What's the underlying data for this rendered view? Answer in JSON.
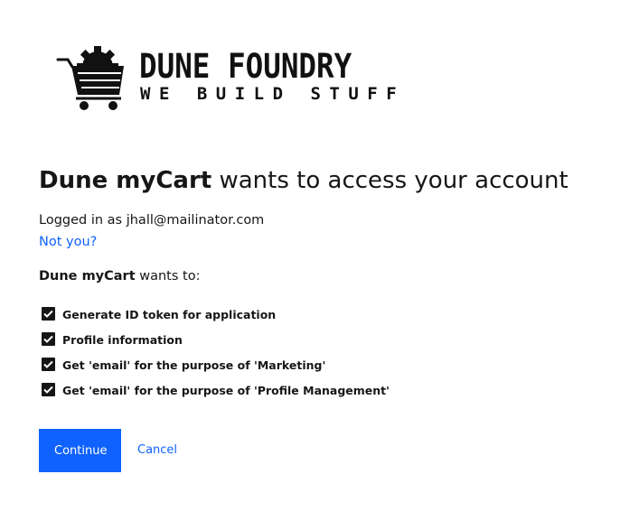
{
  "logo": {
    "title": "DUNE FOUNDRY",
    "tagline": "WE BUILD STUFF",
    "icon": "shopping-cart-gear-icon"
  },
  "consent": {
    "app_name": "Dune myCart",
    "heading_rest": " wants to access your account",
    "logged_in_text": "Logged in as jhall@mailinator.com",
    "not_you_label": "Not you?",
    "wants_to_suffix": " wants to:",
    "scopes": [
      {
        "label": "Generate ID token for application",
        "checked": true
      },
      {
        "label": "Profile information",
        "checked": true
      },
      {
        "label": "Get 'email' for the purpose of 'Marketing'",
        "checked": true
      },
      {
        "label": "Get 'email' for the purpose of 'Profile Management'",
        "checked": true
      }
    ]
  },
  "actions": {
    "continue_label": "Continue",
    "cancel_label": "Cancel"
  },
  "colors": {
    "primary": "#0f62fe",
    "text": "#161616",
    "background": "#ffffff"
  }
}
